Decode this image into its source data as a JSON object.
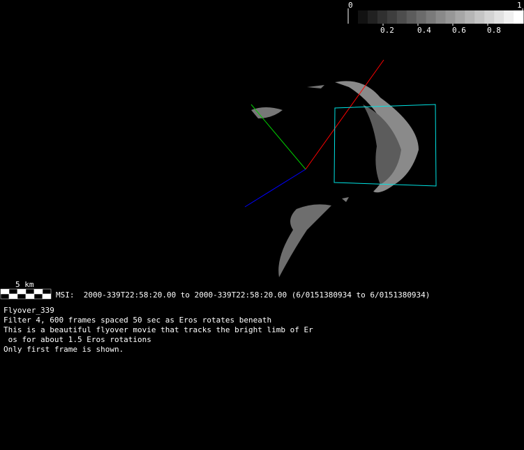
{
  "colorbar": {
    "min_label": "0",
    "max_label": "1",
    "ticks": [
      "0.2",
      "0.4",
      "0.6",
      "0.8"
    ],
    "steps": 17
  },
  "scale_bar": {
    "label": "5 km"
  },
  "msi_line": "MSI:  2000-339T22:58:20.00 to 2000-339T22:58:20.00 (6/0151380934 to 6/0151380934)",
  "description": [
    "Flyover_339",
    "Filter 4, 600 frames spaced 50 sec as Eros rotates beneath",
    "This is a beautiful flyover movie that tracks the bright limb of Er",
    " os for about 1.5 Eros rotations",
    "Only first frame is shown."
  ],
  "colors": {
    "x_axis": "#ff0000",
    "y_axis": "#00cc00",
    "z_axis": "#0000ff",
    "footprint": "#00e5e5"
  }
}
